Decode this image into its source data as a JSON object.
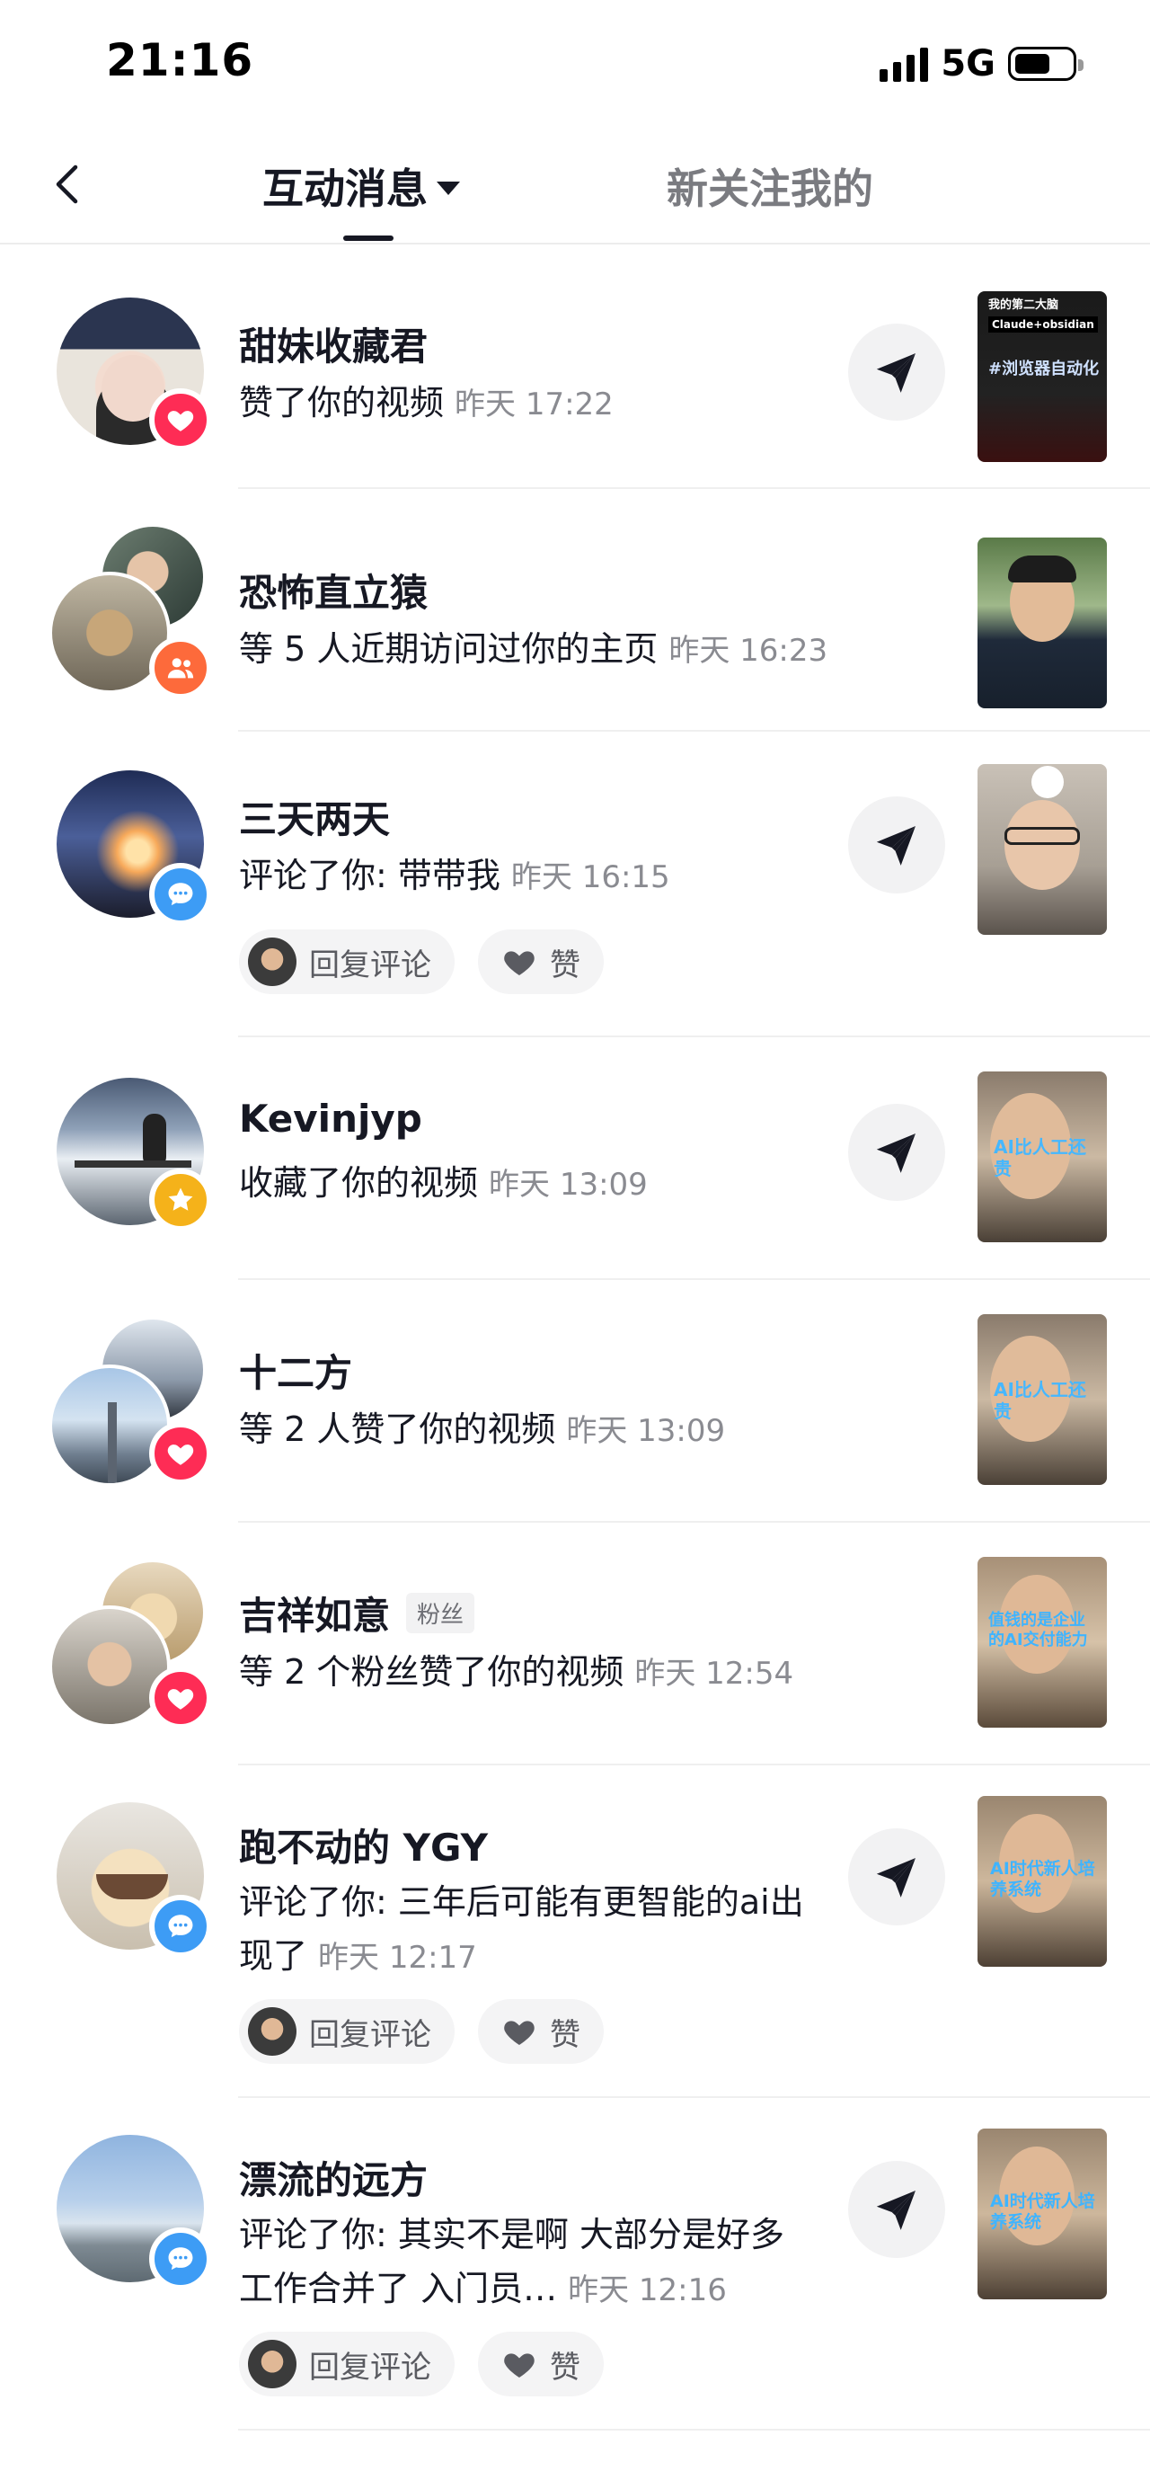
{
  "status_bar": {
    "time": "21:16",
    "network": "5G"
  },
  "header": {
    "tabs": [
      {
        "label": "互动消息",
        "active": true
      },
      {
        "label": "新关注我的",
        "active": false
      }
    ]
  },
  "actions": {
    "reply_label": "回复评论",
    "like_label": "赞"
  },
  "thumb_texts": {
    "t1_line1": "我的第二大脑",
    "t1_line2": "Claude+obsidian",
    "t1_big": "#浏览器自动化",
    "t4_big": "AI比人工还贵",
    "t6_big": "值钱的是企业的AI交付能力",
    "t7_big": "AI时代新人培养系统"
  },
  "items": [
    {
      "name": "甜妹收藏君",
      "text": "赞了你的视频",
      "time": "昨天 17:22",
      "badge": "heart-icon"
    },
    {
      "name": "恐怖直立猿",
      "text": "等 5 人近期访问过你的主页",
      "time": "昨天 16:23",
      "badge": "people-icon"
    },
    {
      "name": "三天两天",
      "text": "评论了你: 带带我",
      "time": "昨天 16:15",
      "badge": "comment-icon"
    },
    {
      "name": "Kevinjyp",
      "text": "收藏了你的视频",
      "time": "昨天 13:09",
      "badge": "star-icon"
    },
    {
      "name": "十二方",
      "text": "等 2 人赞了你的视频",
      "time": "昨天 13:09",
      "badge": "heart-icon"
    },
    {
      "name": "吉祥如意",
      "tag": "粉丝",
      "text": "等 2 个粉丝赞了你的视频",
      "time": "昨天 12:54",
      "badge": "heart-icon"
    },
    {
      "name": "跑不动的 YGY",
      "text": "评论了你: 三年后可能有更智能的ai出现了",
      "time": "昨天 12:17",
      "badge": "comment-icon"
    },
    {
      "name": "漂流的远方",
      "text": "评论了你: 其实不是啊 大部分是好多工作合并了 入门员…",
      "time": "昨天 12:16",
      "badge": "comment-icon"
    }
  ],
  "colors": {
    "like_red": "#fe2c55",
    "comment_blue": "#3d9cf5",
    "star_gold": "#f5b21a",
    "people_orange": "#fd6a3b"
  }
}
